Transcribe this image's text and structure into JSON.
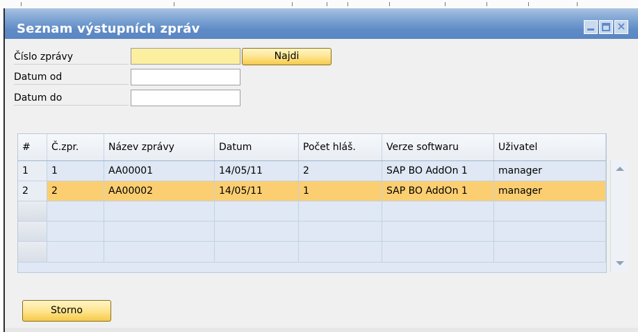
{
  "window": {
    "title": "Seznam výstupních zpráv",
    "controls": [
      "minimize",
      "maximize",
      "close"
    ]
  },
  "form": {
    "message_number_label": "Číslo zprávy",
    "message_number_value": "",
    "date_from_label": "Datum od",
    "date_from_value": "",
    "date_to_label": "Datum do",
    "date_to_value": "",
    "find_button": "Najdi"
  },
  "table": {
    "columns": [
      "#",
      "Č.zpr.",
      "Název zprávy",
      "Datum",
      "Počet hláš.",
      "Verze softwaru",
      "Uživatel"
    ],
    "rows": [
      {
        "index": "1",
        "number": "1",
        "name": "AA00001",
        "date": "14/05/11",
        "count": "2",
        "software": "SAP BO AddOn 1",
        "user": "manager"
      },
      {
        "index": "2",
        "number": "2",
        "name": "AA00002",
        "date": "14/05/11",
        "count": "1",
        "software": "SAP BO AddOn 1",
        "user": "manager"
      }
    ],
    "selected_row": 2
  },
  "footer": {
    "cancel_button": "Storno"
  },
  "colors": {
    "title_bar": "#5f8bc6",
    "button": "#fde38a",
    "selected_row": "#fbcf71",
    "grid": "#dfe8f4",
    "focus_field": "#fcef9f"
  }
}
